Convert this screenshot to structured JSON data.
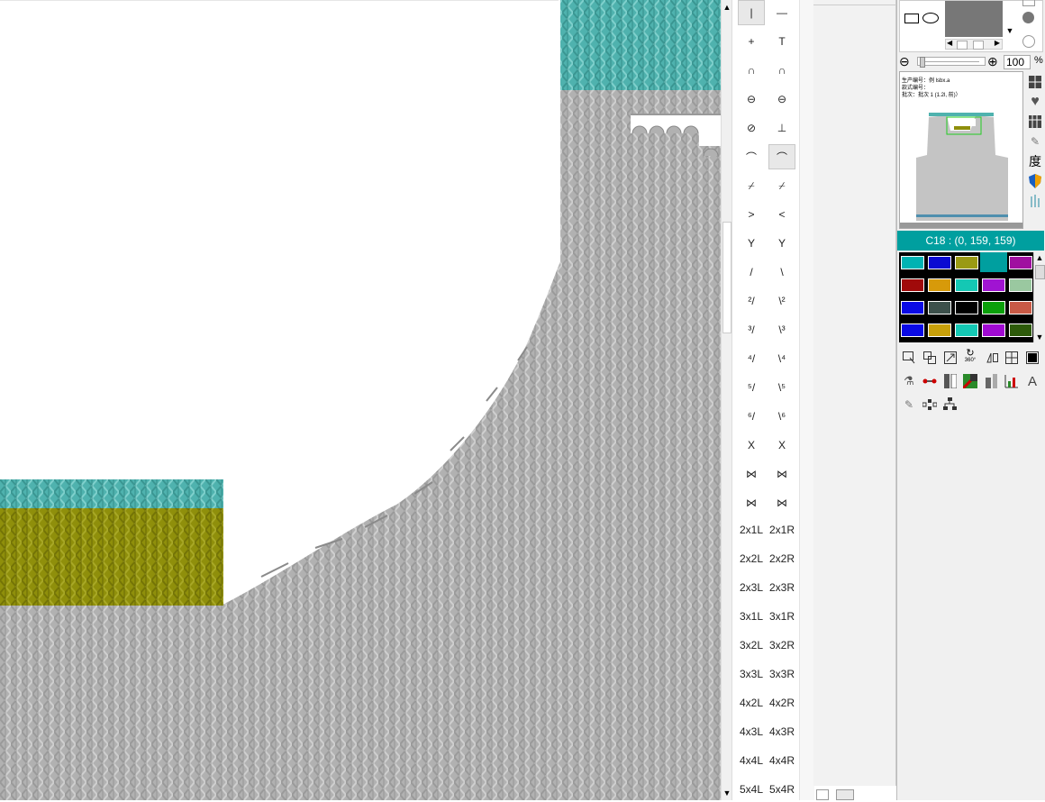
{
  "canvas": {
    "colors": {
      "grey": "#b3b3b3",
      "teal": "#4fb2ae",
      "olive": "#8f8f0b"
    }
  },
  "palette": {
    "current_color": "C18 : (0, 159, 159)",
    "current_hex": "#009f9f",
    "swatches": [
      "#00b3b3",
      "#0a0ad2",
      "#9a9a14",
      "#009f9f",
      "#a010a0",
      "#a00a0a",
      "#d79a0a",
      "#14c8b4",
      "#a014d2",
      "#9ac8a0",
      "#0a0ae6",
      "#3c504b",
      "#000000",
      "#0aa00a",
      "#c85a46",
      "#0a0ae6",
      "#c8a00a",
      "#14c8b4",
      "#a00ad2",
      "#2d5a0a"
    ]
  },
  "zoom": {
    "value": "100",
    "unit": "%"
  },
  "preview": {
    "text_line1": "生产编号：例 lsbx.a",
    "text_line2": "款式编号：",
    "text_line3": "批次：批次 1 (1.2l, 前)）"
  },
  "stitch_tools": [
    {
      "left": "|",
      "right": "—"
    },
    {
      "left": "+",
      "right": "T"
    },
    {
      "left": "∩",
      "right": "∩"
    },
    {
      "left": "⊖",
      "right": "⊖"
    },
    {
      "left": "⊘",
      "right": "⊥"
    },
    {
      "left": "⌒",
      "right": "⌒"
    },
    {
      "left": "⌿",
      "right": "⌿"
    },
    {
      "left": ">",
      "right": "<"
    },
    {
      "left": "Y",
      "right": "Y"
    },
    {
      "left": "/",
      "right": "\\"
    },
    {
      "left": "²/",
      "right": "\\²"
    },
    {
      "left": "³/",
      "right": "\\³"
    },
    {
      "left": "⁴/",
      "right": "\\⁴"
    },
    {
      "left": "⁵/",
      "right": "\\⁵"
    },
    {
      "left": "⁶/",
      "right": "\\⁶"
    },
    {
      "left": "X",
      "right": "X"
    },
    {
      "left": "⋈",
      "right": "⋈"
    },
    {
      "left": "⋈",
      "right": "⋈"
    },
    {
      "left": "2x1L",
      "right": "2x1R"
    },
    {
      "left": "2x2L",
      "right": "2x2R"
    },
    {
      "left": "2x3L",
      "right": "2x3R"
    },
    {
      "left": "3x1L",
      "right": "3x1R"
    },
    {
      "left": "3x2L",
      "right": "3x2R"
    },
    {
      "left": "3x3L",
      "right": "3x3R"
    },
    {
      "left": "4x2L",
      "right": "4x2R"
    },
    {
      "left": "4x3L",
      "right": "4x3R"
    },
    {
      "left": "4x4L",
      "right": "4x4R"
    },
    {
      "left": "5x4L",
      "right": "5x4R"
    }
  ],
  "side_icons": [
    "grid-icon",
    "heart-icon",
    "table-icon",
    "pen-icon",
    "degree-icon",
    "shield-icon",
    "bars-icon"
  ],
  "side_icon_text": {
    "degree": "度"
  },
  "tool_icons_row1": [
    "select-icon",
    "copy-icon",
    "resize-icon",
    "rotate-icon",
    "mirror-icon",
    "split-icon",
    "fill-black-icon"
  ],
  "tool_icons_row2": [
    "paint-icon",
    "link-icon",
    "column-icon",
    "slash-icon",
    "measure-icon",
    "chart-icon",
    "text-icon"
  ],
  "tool_icons_row3": [
    "pen-small-icon",
    "flow-icon",
    "tree-icon"
  ],
  "rotate_label": "360°"
}
